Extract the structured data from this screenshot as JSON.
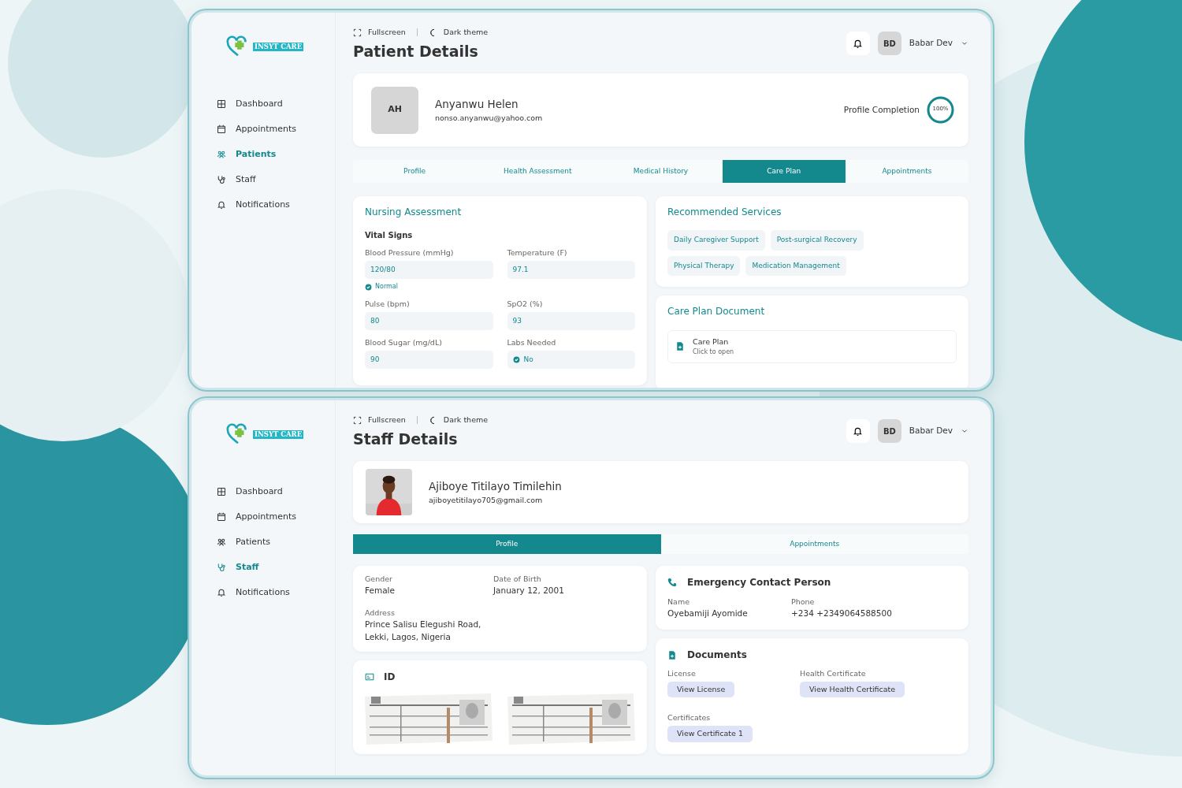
{
  "screens": [
    {
      "logo": "INSYT CARE",
      "nav": [
        {
          "label": "Dashboard",
          "selected": false
        },
        {
          "label": "Appointments",
          "selected": false
        },
        {
          "label": "Patients",
          "selected": true
        },
        {
          "label": "Staff",
          "selected": false
        },
        {
          "label": "Notifications",
          "selected": false
        }
      ],
      "toolbar": [
        "Fullscreen",
        "Dark theme"
      ],
      "user": {
        "initials": "BD",
        "name": "Babar Dev"
      },
      "title": "Patient Details",
      "profile": {
        "initials": "AH",
        "name": "Anyanwu Helen",
        "email": "nonso.anyanwu@yahoo.com",
        "completion_label": "Profile Completion",
        "completion": "100%",
        "level": 1
      },
      "tabs": [
        {
          "label": "Profile",
          "selected": false
        },
        {
          "label": "Health Assessment",
          "selected": false
        },
        {
          "label": "Medical History",
          "selected": false
        },
        {
          "label": "Care Plan",
          "selected": true
        },
        {
          "label": "Appointments",
          "selected": false
        }
      ],
      "nursing": {
        "title": "Nursing Assessment",
        "subtitle": "Vital Signs",
        "vitals": [
          {
            "label": "Blood Pressure (mmHg)",
            "value": "120/80",
            "kind": "text",
            "status": "Normal"
          },
          {
            "label": "Temperature (F)",
            "value": "97.1",
            "kind": "text"
          },
          {
            "label": "Pulse (bpm)",
            "value": "80",
            "kind": "text"
          },
          {
            "label": "SpO2 (%)",
            "value": "93",
            "kind": "text"
          },
          {
            "label": "Blood Sugar (mg/dL)",
            "value": "90",
            "kind": "text"
          },
          {
            "label": "Labs Needed",
            "value": "No",
            "kind": "check"
          }
        ]
      },
      "services": {
        "title": "Recommended Services",
        "items": [
          "Daily Caregiver Support",
          "Post-surgical Recovery",
          "Physical Therapy",
          "Medication Management"
        ]
      },
      "document": {
        "title": "Care Plan Document",
        "name": "Care Plan",
        "hint": "Click to open"
      }
    },
    {
      "logo": "INSYT CARE",
      "nav": [
        {
          "label": "Dashboard",
          "selected": false
        },
        {
          "label": "Appointments",
          "selected": false
        },
        {
          "label": "Patients",
          "selected": false
        },
        {
          "label": "Staff",
          "selected": true
        },
        {
          "label": "Notifications",
          "selected": false
        }
      ],
      "toolbar": [
        "Fullscreen",
        "Dark theme"
      ],
      "user": {
        "initials": "BD",
        "name": "Babar Dev"
      },
      "title": "Staff Details",
      "profile": {
        "name": "Ajiboye Titilayo Timilehin",
        "email": "ajiboyetitilayo705@gmail.com"
      },
      "tabs": [
        {
          "label": "Profile",
          "selected": true
        },
        {
          "label": "Appointments",
          "selected": false
        }
      ],
      "details": [
        {
          "label": "Gender",
          "value": "Female"
        },
        {
          "label": "Date of Birth",
          "value": "January 12, 2001"
        },
        {
          "label": "Address",
          "value": "Prince Salisu Elegushi Road, Lekki, Lagos, Nigeria"
        }
      ],
      "id_card": {
        "title": "ID"
      },
      "emergency": {
        "title": "Emergency Contact Person",
        "fields": [
          {
            "label": "Name",
            "value": "Oyebamiji Ayomide"
          },
          {
            "label": "Phone",
            "value": "+234 +2349064588500"
          }
        ]
      },
      "documents": {
        "title": "Documents",
        "groups": [
          {
            "label": "License",
            "buttons": [
              "View License"
            ]
          },
          {
            "label": "Health Certificate",
            "buttons": [
              "View Health Certificate"
            ]
          },
          {
            "label": "Certificates",
            "buttons": [
              "View Certificate 1"
            ]
          }
        ]
      }
    }
  ]
}
